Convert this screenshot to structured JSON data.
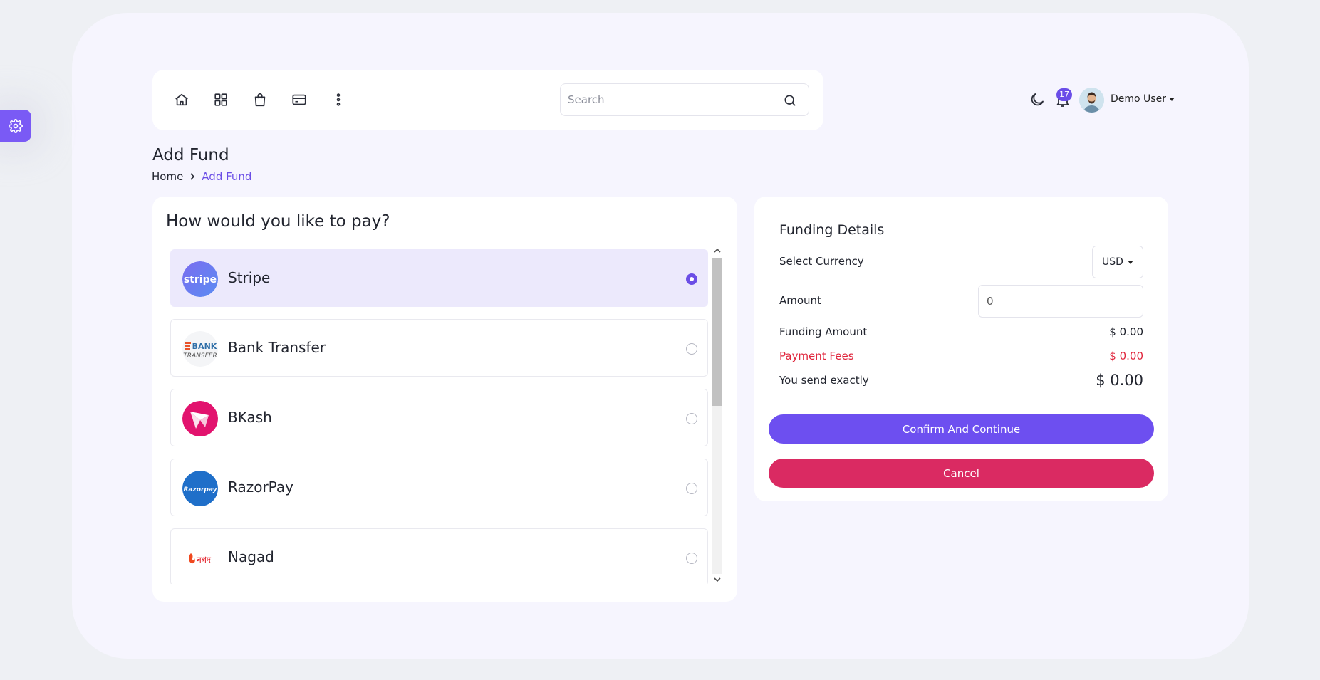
{
  "nav": {
    "icons": [
      "home-icon",
      "grid-icon",
      "bag-icon",
      "card-icon",
      "more-vertical-icon"
    ],
    "search_placeholder": "Search"
  },
  "header": {
    "notification_count": "17",
    "user_name": "Demo User"
  },
  "page": {
    "title": "Add Fund",
    "breadcrumb": [
      "Home",
      "Add Fund"
    ]
  },
  "payment": {
    "question": "How would you like to pay?",
    "methods": [
      {
        "name": "Stripe",
        "selected": true,
        "icon": "stripe-logo"
      },
      {
        "name": "Bank Transfer",
        "selected": false,
        "icon": "bank-transfer-logo"
      },
      {
        "name": "BKash",
        "selected": false,
        "icon": "bkash-logo"
      },
      {
        "name": "RazorPay",
        "selected": false,
        "icon": "razorpay-logo"
      },
      {
        "name": "Nagad",
        "selected": false,
        "icon": "nagad-logo"
      }
    ],
    "logo_text": {
      "stripe": "stripe",
      "bank_top": "BANK",
      "bank_bottom": "TRANSFER",
      "razorpay": "Razorpay",
      "nagad": "নগদ"
    }
  },
  "funding": {
    "title": "Funding Details",
    "select_currency_label": "Select Currency",
    "currency": "USD",
    "amount_label": "Amount",
    "amount_value": "0",
    "funding_amount_label": "Funding Amount",
    "funding_amount_value": "$ 0.00",
    "payment_fees_label": "Payment Fees",
    "payment_fees_value": "$ 0.00",
    "send_exactly_label": "You send exactly",
    "send_exactly_value": "$ 0.00",
    "confirm_label": "Confirm And Continue",
    "cancel_label": "Cancel"
  },
  "colors": {
    "accent": "#6d4ff0",
    "danger": "#da2a62",
    "fees_red": "#e0253c",
    "selected_row": "#ece9fc"
  }
}
